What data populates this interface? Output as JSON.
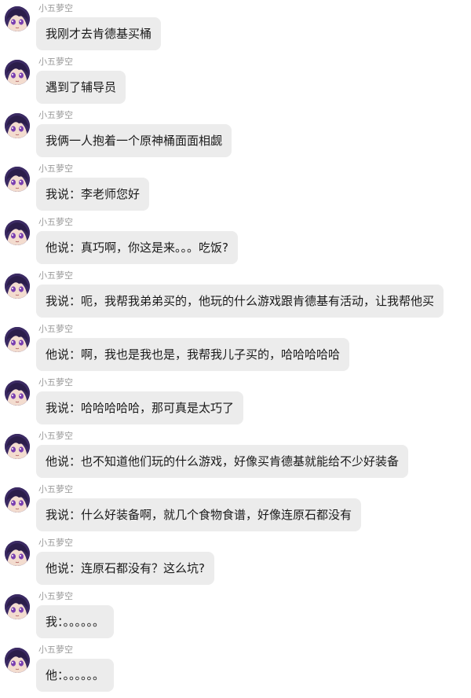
{
  "chat": {
    "messages": [
      {
        "sender": "小五萝空",
        "text": "我刚才去肯德基买桶"
      },
      {
        "sender": "小五萝空",
        "text": "遇到了辅导员"
      },
      {
        "sender": "小五萝空",
        "text": "我俩一人抱着一个原神桶面面相觑"
      },
      {
        "sender": "小五萝空",
        "text": "我说：李老师您好"
      },
      {
        "sender": "小五萝空",
        "text": "他说：真巧啊，你这是来。。。吃饭?"
      },
      {
        "sender": "小五萝空",
        "text": "我说：呃，我帮我弟弟买的，他玩的什么游戏跟肯德基有活动，让我帮他买"
      },
      {
        "sender": "小五萝空",
        "text": "他说：啊，我也是我也是，我帮我儿子买的，哈哈哈哈哈"
      },
      {
        "sender": "小五萝空",
        "text": "我说：哈哈哈哈哈，那可真是太巧了"
      },
      {
        "sender": "小五萝空",
        "text": "他说：也不知道他们玩的什么游戏，好像买肯德基就能给不少好装备"
      },
      {
        "sender": "小五萝空",
        "text": "我说：什么好装备啊，就几个食物食谱，好像连原石都没有"
      },
      {
        "sender": "小五萝空",
        "text": "他说：连原石都没有？这么坑?"
      },
      {
        "sender": "小五萝空",
        "text": "我：。。。。。。"
      },
      {
        "sender": "小五萝空",
        "text": "他：。。。。。。"
      }
    ]
  },
  "colors": {
    "bubble": "#ececec",
    "sender": "#9a9a9a",
    "text": "#1a1a1a",
    "avatar_hair": "#3b2a63",
    "avatar_eyes": "#7a3fb0"
  },
  "icons": {
    "avatar": "anime-girl-avatar-icon"
  }
}
